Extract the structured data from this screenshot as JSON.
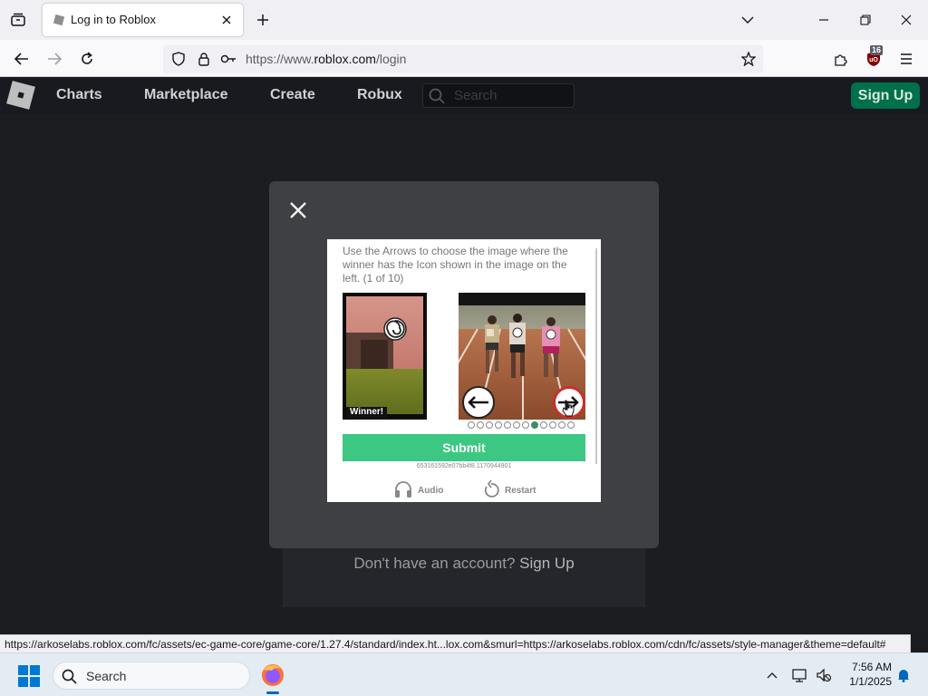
{
  "browser": {
    "tab_title": "Log in to Roblox",
    "url_prefix": "https://www.",
    "url_host": "roblox.com",
    "url_path": "/login",
    "extension_badge": "16",
    "status_url": "https://arkoselabs.roblox.com/fc/assets/ec-game-core/game-core/1.27.4/standard/index.ht...lox.com&smurl=https://arkoselabs.roblox.com/cdn/fc/assets/style-manager&theme=default#"
  },
  "roblox_header": {
    "nav": [
      "Charts",
      "Marketplace",
      "Create",
      "Robux"
    ],
    "search_placeholder": "Search",
    "signup_label": "Sign Up"
  },
  "page": {
    "no_account_text": "Don't have an account?",
    "signup_link": "Sign Up"
  },
  "captcha": {
    "instruction": "Use the Arrows to choose the image where the winner has the Icon shown in the image on the left. (1 of 10)",
    "reference_label": "Winner!",
    "dots_total": 12,
    "dots_active_index": 7,
    "submit_label": "Submit",
    "session_id": "653161592e07bb4f8.1170944901",
    "audio_label": "Audio",
    "restart_label": "Restart"
  },
  "taskbar": {
    "search_label": "Search",
    "time": "7:56 AM",
    "date": "1/1/2025"
  },
  "colors": {
    "roblox_signup": "#00704a",
    "captcha_submit": "#3cc882",
    "active_dot": "#3a8f63",
    "arrow_highlight": "#c9302c"
  }
}
